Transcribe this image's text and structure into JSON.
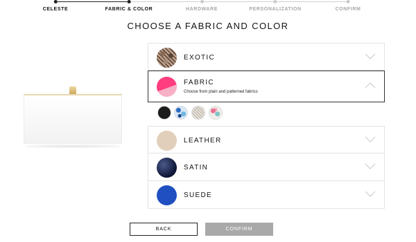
{
  "steps": [
    {
      "label": "CELESTE",
      "state": "done"
    },
    {
      "label": "FABRIC & COLOR",
      "state": "current"
    },
    {
      "label": "HARDWARE",
      "state": "todo"
    },
    {
      "label": "PERSONALIZATION",
      "state": "todo"
    },
    {
      "label": "CONFIRM",
      "state": "todo"
    }
  ],
  "title": "CHOOSE A FABRIC AND COLOR",
  "materials": [
    {
      "name": "EXOTIC",
      "swatch": "snakeskin-brown"
    },
    {
      "name": "FABRIC",
      "subtitle": "Choose from plain and patterned fabrics",
      "swatch": "pink-#ff3d7f",
      "expanded": true
    },
    {
      "name": "LEATHER",
      "swatch": "beige-#e2cfbb"
    },
    {
      "name": "SATIN",
      "swatch": "navy-#0c1433"
    },
    {
      "name": "SUEDE",
      "swatch": "blue-#1f4fc0"
    }
  ],
  "fabric_swatches": [
    "black",
    "blue-floral",
    "tweed",
    "pastel-floral"
  ],
  "buttons": {
    "back": "BACK",
    "confirm": "CONFIRM"
  },
  "colors": {
    "text": "#111111",
    "inactive_step": "#a6a6a6",
    "confirm_disabled": "#a9a9a9"
  }
}
